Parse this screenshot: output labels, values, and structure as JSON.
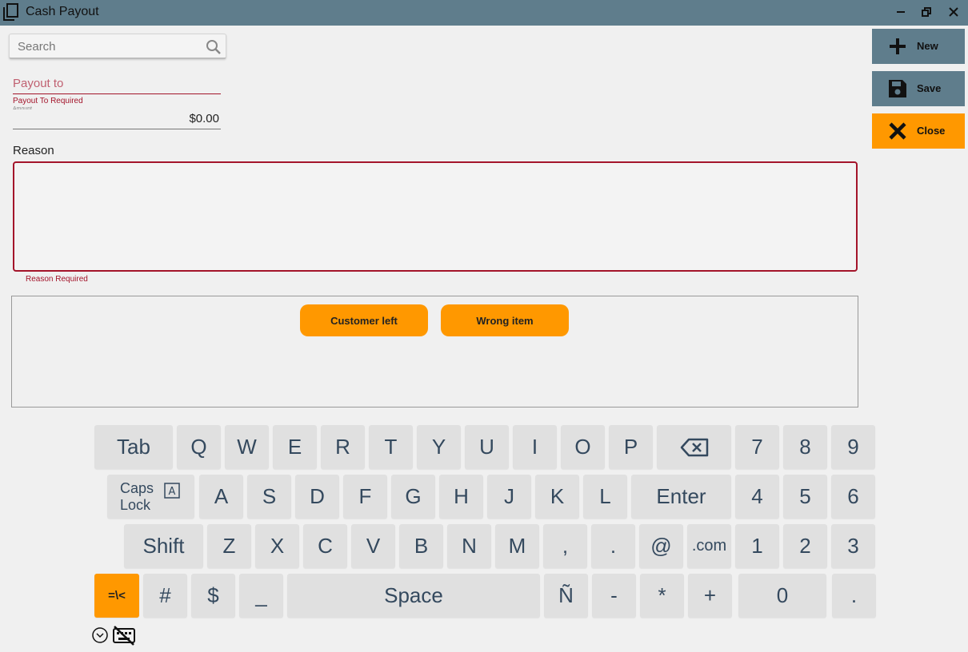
{
  "window": {
    "title": "Cash Payout",
    "titlebar_color": "#5f7d8c"
  },
  "search": {
    "placeholder": "Search"
  },
  "form": {
    "payout_to_placeholder": "Payout to",
    "payout_to_error": "Payout To Required",
    "amount_label": "Amount",
    "amount_value": "$0.00",
    "reason_label": "Reason",
    "reason_value": "",
    "reason_error": "Reason Required"
  },
  "quick_reasons": [
    "Customer left",
    "Wrong item"
  ],
  "side_buttons": {
    "new_label": "New",
    "save_label": "Save",
    "close_label": "Close"
  },
  "keyboard": {
    "row1": [
      "Tab",
      "Q",
      "W",
      "E",
      "R",
      "T",
      "Y",
      "U",
      "I",
      "O",
      "P"
    ],
    "backspace_icon": "backspace-icon",
    "numpad_row1": [
      "7",
      "8",
      "9"
    ],
    "caps_line1": "Caps",
    "caps_line2": "Lock",
    "caps_indicator": "A",
    "row2": [
      "A",
      "S",
      "D",
      "F",
      "G",
      "H",
      "J",
      "K",
      "L"
    ],
    "enter": "Enter",
    "numpad_row2": [
      "4",
      "5",
      "6"
    ],
    "shift": "Shift",
    "row3": [
      "Z",
      "X",
      "C",
      "V",
      "B",
      "N",
      "M",
      ",",
      ".",
      "@",
      ".com"
    ],
    "numpad_row3": [
      "1",
      "2",
      "3"
    ],
    "symbols_toggle": "=\\<",
    "row4": [
      "#",
      "$",
      "_"
    ],
    "space": "Space",
    "row4b": [
      "Ñ",
      "-",
      "*",
      "+"
    ],
    "zero": "0",
    "decimal": ".",
    "accent_color": "#ff9800"
  }
}
